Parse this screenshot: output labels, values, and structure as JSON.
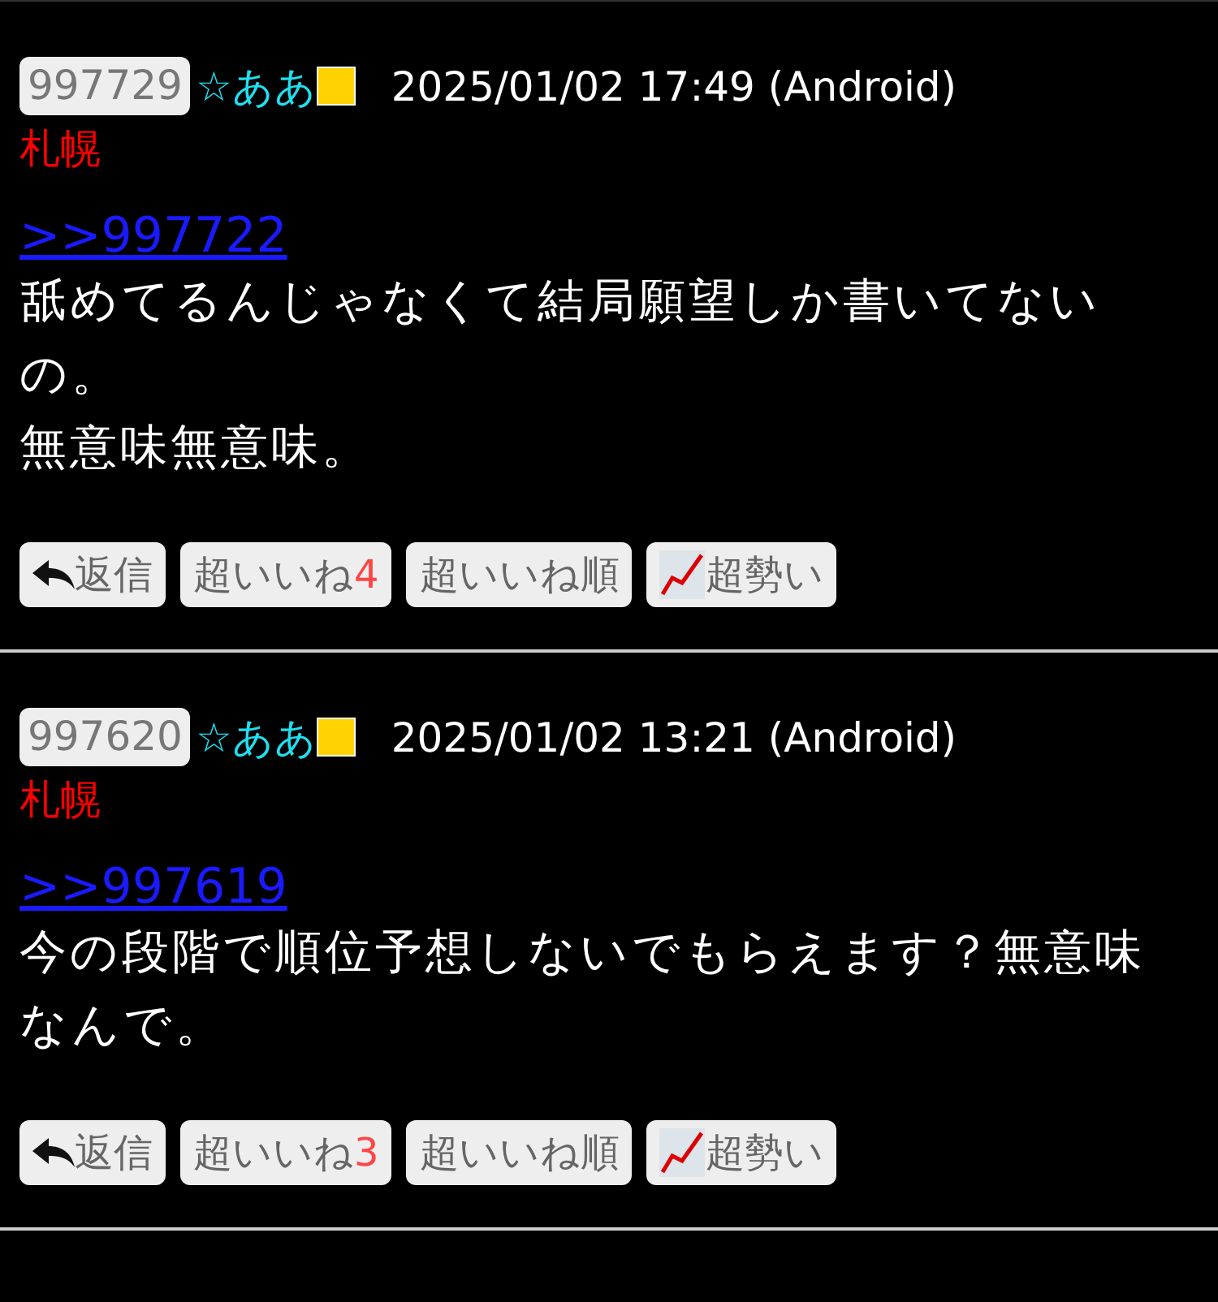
{
  "posts": [
    {
      "number": "997729",
      "name": "☆ああ",
      "date": "2025/01/02 17:49 (Android)",
      "location": "札幌",
      "reply_to": ">>997722",
      "body": [
        "舐めてるんじゃなくて結局願望しか書いてないの。",
        "無意味無意味。"
      ],
      "buttons": [
        {
          "kind": "reply",
          "label": "返信"
        },
        {
          "kind": "like",
          "label": "超いいね",
          "count": "4"
        },
        {
          "kind": "plain",
          "label": "超いいね順"
        },
        {
          "kind": "trend",
          "label": "超勢い"
        }
      ]
    },
    {
      "number": "997620",
      "name": "☆ああ",
      "date": "2025/01/02 13:21 (Android)",
      "location": "札幌",
      "reply_to": ">>997619",
      "body": [
        "今の段階で順位予想しないでもらえます？無意味なんで。"
      ],
      "buttons": [
        {
          "kind": "reply",
          "label": "返信"
        },
        {
          "kind": "like",
          "label": "超いいね",
          "count": "3"
        },
        {
          "kind": "plain",
          "label": "超いいね順"
        },
        {
          "kind": "trend",
          "label": "超勢い"
        }
      ]
    }
  ]
}
